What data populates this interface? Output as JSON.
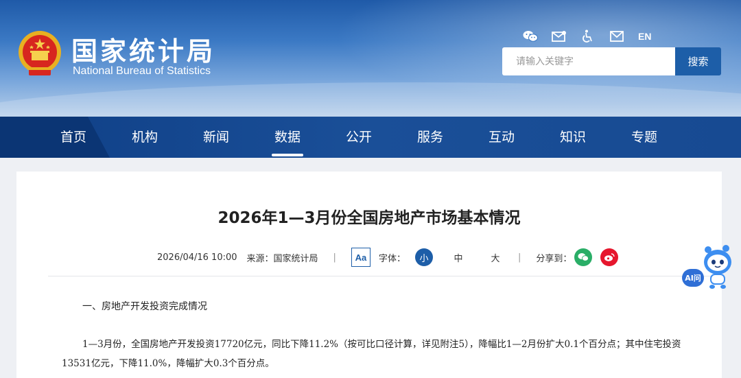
{
  "header": {
    "title_cn": "国家统计局",
    "title_en": "National Bureau of Statistics",
    "lang_label": "EN",
    "icons": [
      "wechat-icon",
      "mail-envelope-icon",
      "accessibility-icon",
      "email-icon"
    ],
    "search": {
      "placeholder": "请输入关键字",
      "button_label": "搜索"
    }
  },
  "nav": {
    "items": [
      {
        "label": "首页"
      },
      {
        "label": "机构"
      },
      {
        "label": "新闻"
      },
      {
        "label": "数据"
      },
      {
        "label": "公开"
      },
      {
        "label": "服务"
      },
      {
        "label": "互动"
      },
      {
        "label": "知识"
      },
      {
        "label": "专题"
      }
    ],
    "active": "数据"
  },
  "article": {
    "title": "2026年1—3月份全国房地产市场基本情况",
    "datetime": "2026/04/16 10:00",
    "source": "来源：国家统计局",
    "sep": "|",
    "aa_label": "Aa",
    "font_label": "字体：",
    "font_sizes": [
      "小",
      "中",
      "大"
    ],
    "share_label": "分享到：",
    "section_heading": "一、房地产开发投资完成情况",
    "paragraph": "1—3月份，全国房地产开发投资17720亿元，同比下降11.2%（按可比口径计算，详见附注5），降幅比1—2月份扩大0.1个百分点；其中住宅投资13531亿元，下降11.0%，降幅扩大0.3个百分点。"
  },
  "ai_widget": {
    "label": "AI问"
  },
  "colors": {
    "primary": "#1d5ea8",
    "nav": "#174a92",
    "wechat": "#2aae67",
    "weibo": "#e6162d"
  }
}
